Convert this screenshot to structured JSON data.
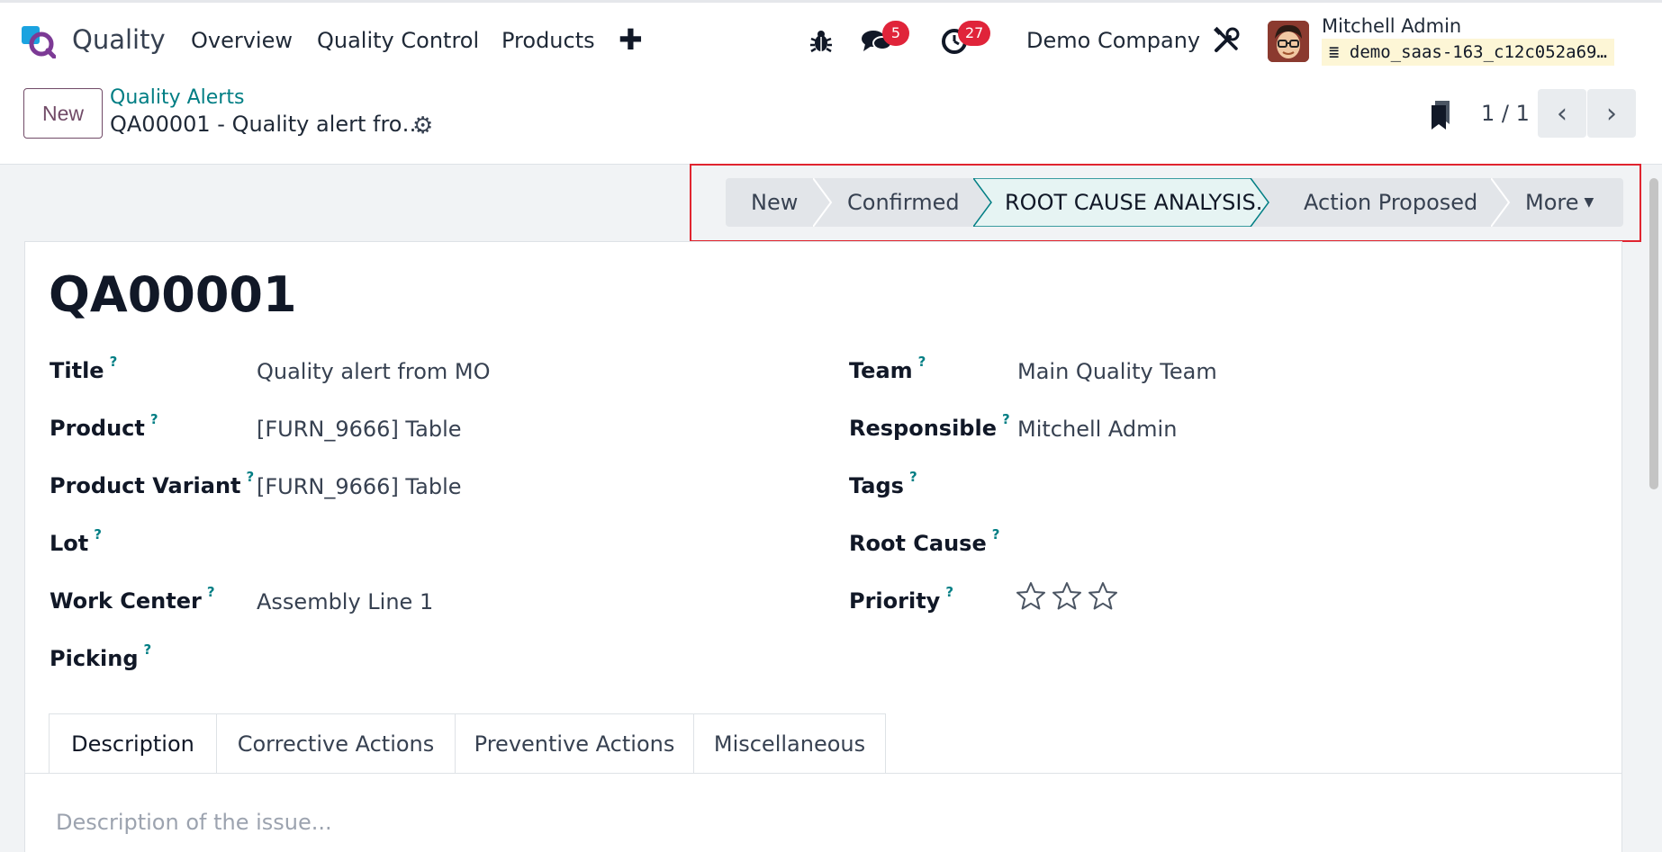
{
  "app": {
    "name": "Quality"
  },
  "nav": [
    {
      "label": "Overview"
    },
    {
      "label": "Quality Control"
    },
    {
      "label": "Products"
    }
  ],
  "systray": {
    "messages_count": "5",
    "activities_count": "27",
    "company": "Demo Company",
    "user_name": "Mitchell Admin",
    "database": "demo_saas-163_c12c052a69…"
  },
  "control_panel": {
    "new_label": "New",
    "breadcrumb": "Quality Alerts",
    "record_title": "QA00001 - Quality alert fro…",
    "pager": "1 / 1"
  },
  "statusbar": {
    "stages": [
      "New",
      "Confirmed",
      "ROOT CAUSE ANALYSIS.",
      "Action Proposed"
    ],
    "active_stage": "ROOT CAUSE ANALYSIS.",
    "more_label": "More"
  },
  "form": {
    "reference": "QA00001",
    "help_mark": "?",
    "fields_left": [
      {
        "label": "Title",
        "value": "Quality alert from MO"
      },
      {
        "label": "Product",
        "value": "[FURN_9666] Table"
      },
      {
        "label": "Product Variant",
        "value": "[FURN_9666] Table"
      },
      {
        "label": "Lot",
        "value": ""
      },
      {
        "label": "Work Center",
        "value": "Assembly Line 1"
      },
      {
        "label": "Picking",
        "value": ""
      }
    ],
    "fields_right": [
      {
        "label": "Team",
        "value": "Main Quality Team"
      },
      {
        "label": "Responsible",
        "value": "Mitchell Admin"
      },
      {
        "label": "Tags",
        "value": ""
      },
      {
        "label": "Root Cause",
        "value": ""
      },
      {
        "label": "Priority",
        "value": ""
      }
    ],
    "priority_stars": 0,
    "priority_max": 3
  },
  "tabs": [
    "Description",
    "Corrective Actions",
    "Preventive Actions",
    "Miscellaneous"
  ],
  "description_placeholder": "Description of the issue...",
  "colors": {
    "brand": "#714b67",
    "accent": "#017e84",
    "badge": "#e0243a",
    "highlight": "#e0242f"
  }
}
